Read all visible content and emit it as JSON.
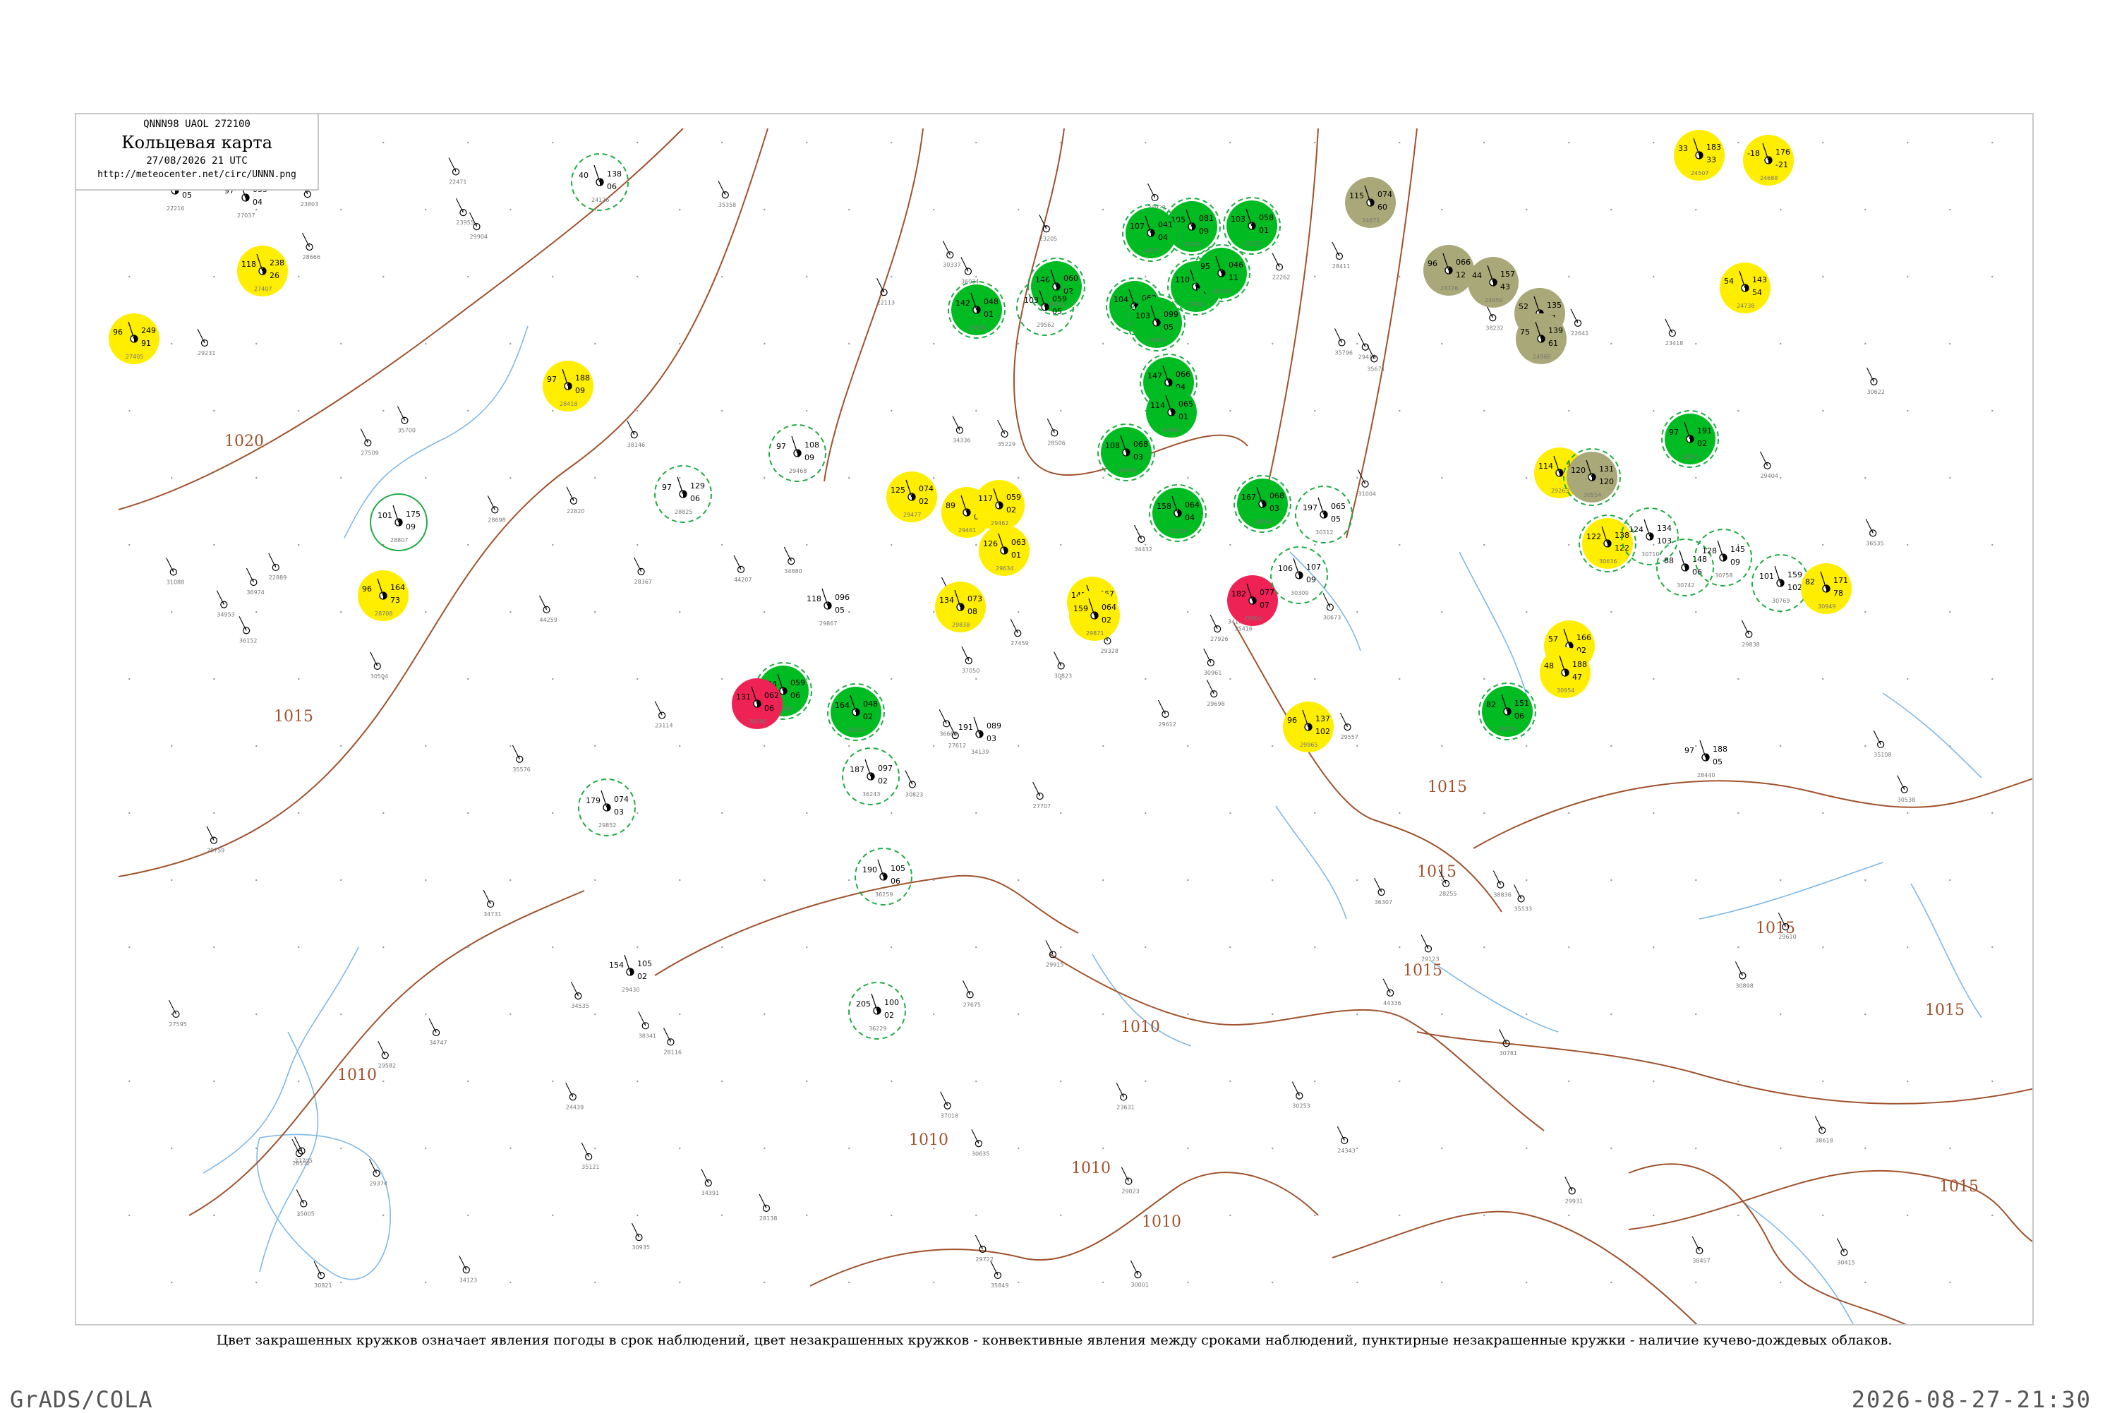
{
  "header": {
    "code": "QNNN98  UAOL  272100",
    "title": "Кольцевая карта",
    "date": "27/08/2026 21 UTC",
    "url": "http://meteocenter.net/circ/UNNN.png"
  },
  "caption": "Цвет закрашенных кружков означает явления погоды в срок наблюдений, цвет незакрашенных кружков - конвективные явления между сроками наблюдений, пунктирные незакрашенные кружки - наличие кучево-дождевых облаков.",
  "footer": {
    "left": "GrADS/COLA",
    "right": "2026-08-27-21:30"
  },
  "colors": {
    "isobar": "#a0522d",
    "river": "#7fb8e6",
    "green": "#00bb22",
    "yellow": "#ffee00",
    "red": "#ee2255",
    "olive": "#a8a878",
    "cb_ring": "#22aa44"
  },
  "isobar_labels": [
    {
      "value": "1020"
    },
    {
      "value": "1015"
    },
    {
      "value": "1015"
    },
    {
      "value": "1015"
    },
    {
      "value": "1015"
    },
    {
      "value": "1015"
    },
    {
      "value": "1010"
    },
    {
      "value": "1010"
    },
    {
      "value": "1010"
    },
    {
      "value": "1010"
    },
    {
      "value": "1010"
    },
    {
      "value": "1015"
    },
    {
      "value": "1015"
    }
  ],
  "stations": [
    {
      "p": "143",
      "t": "97",
      "d": "05",
      "name": "27216",
      "fill": "none",
      "ring": "none"
    },
    {
      "p": "035",
      "t": "97",
      "d": "04",
      "name": "27037",
      "fill": "none",
      "ring": "none"
    },
    {
      "p": "238",
      "t": "118",
      "d": "26",
      "name": "27407",
      "fill": "yellow",
      "ring": "none"
    },
    {
      "p": "249",
      "t": "96",
      "d": "91",
      "name": "27405",
      "fill": "yellow",
      "ring": "none"
    },
    {
      "p": "188",
      "t": "97",
      "d": "09",
      "name": "28418",
      "fill": "yellow",
      "ring": "none"
    },
    {
      "p": "175",
      "t": "101",
      "d": "09",
      "name": "28807",
      "fill": "none",
      "ring": "solid"
    },
    {
      "p": "164",
      "t": "96",
      "d": "73",
      "name": "28708",
      "fill": "yellow",
      "ring": "none"
    },
    {
      "p": "138",
      "t": "40",
      "d": "06",
      "name": "24126",
      "fill": "none",
      "ring": "cb"
    },
    {
      "p": "129",
      "t": "97",
      "d": "06",
      "name": "28825",
      "fill": "none",
      "ring": "cb"
    },
    {
      "p": "108",
      "t": "97",
      "d": "09",
      "name": "29468",
      "fill": "none",
      "ring": "cb"
    },
    {
      "p": "074",
      "t": "125",
      "d": "02",
      "name": "29477",
      "fill": "yellow",
      "ring": "none"
    },
    {
      "p": "063",
      "t": "89",
      "d": "02",
      "name": "29461",
      "fill": "yellow",
      "ring": "none"
    },
    {
      "p": "059",
      "t": "117",
      "d": "02",
      "name": "29462",
      "fill": "yellow",
      "ring": "none"
    },
    {
      "p": "063",
      "t": "126",
      "d": "01",
      "name": "29634",
      "fill": "yellow",
      "ring": "none"
    },
    {
      "p": "073",
      "t": "134",
      "d": "08",
      "name": "29838",
      "fill": "yellow",
      "ring": "none"
    },
    {
      "p": "096",
      "t": "118",
      "d": "05",
      "name": "29867",
      "fill": "none",
      "ring": "none"
    },
    {
      "p": "074",
      "t": "179",
      "d": "03",
      "name": "29852",
      "fill": "none",
      "ring": "cb"
    },
    {
      "p": "059",
      "t": "104",
      "d": "06",
      "name": "36086",
      "fill": "green",
      "ring": "cb"
    },
    {
      "p": "062",
      "t": "131",
      "d": "06",
      "name": "36096",
      "fill": "red",
      "ring": "none"
    },
    {
      "p": "048",
      "t": "164",
      "d": "02",
      "name": "36177",
      "fill": "green",
      "ring": "cb"
    },
    {
      "p": "097",
      "t": "187",
      "d": "02",
      "name": "36243",
      "fill": "none",
      "ring": "cb"
    },
    {
      "p": "100",
      "t": "205",
      "d": "02",
      "name": "36229",
      "fill": "none",
      "ring": "cb"
    },
    {
      "p": "105",
      "t": "190",
      "d": "06",
      "name": "36259",
      "fill": "none",
      "ring": "cb"
    },
    {
      "p": "048",
      "t": "142",
      "d": "01",
      "name": "29638",
      "fill": "green",
      "ring": "cb"
    },
    {
      "p": "060",
      "t": "146",
      "d": "02",
      "name": "29541",
      "fill": "green",
      "ring": "cb"
    },
    {
      "p": "059",
      "t": "103",
      "d": "05",
      "name": "29562",
      "fill": "none",
      "ring": "cb"
    },
    {
      "p": "062",
      "t": "104",
      "d": "04",
      "name": "29572",
      "fill": "green",
      "ring": "cb"
    },
    {
      "p": "081",
      "t": "105",
      "d": "09",
      "name": "29263",
      "fill": "green",
      "ring": "cb"
    },
    {
      "p": "084",
      "t": "110",
      "d": "03",
      "name": "29282",
      "fill": "green",
      "ring": "cb"
    },
    {
      "p": "099",
      "t": "103",
      "d": "05",
      "name": "29363",
      "fill": "green",
      "ring": "cb"
    },
    {
      "p": "066",
      "t": "147",
      "d": "04",
      "name": "29651",
      "fill": "green",
      "ring": "cb"
    },
    {
      "p": "067",
      "t": "145",
      "d": "02",
      "name": "29894",
      "fill": "yellow",
      "ring": "none"
    },
    {
      "p": "064",
      "t": "158",
      "d": "04",
      "name": "30104",
      "fill": "green",
      "ring": "cb"
    },
    {
      "p": "064",
      "t": "159",
      "d": "02",
      "name": "29871",
      "fill": "yellow",
      "ring": "none"
    },
    {
      "p": "068",
      "t": "167",
      "d": "03",
      "name": "30054",
      "fill": "green",
      "ring": "cb"
    },
    {
      "p": "077",
      "t": "182",
      "d": "07",
      "name": "29900",
      "fill": "red",
      "ring": "none"
    },
    {
      "p": "107",
      "t": "106",
      "d": "09",
      "name": "30309",
      "fill": "none",
      "ring": "cb"
    },
    {
      "p": "065",
      "t": "197",
      "d": "05",
      "name": "30312",
      "fill": "none",
      "ring": "cb"
    },
    {
      "p": "137",
      "t": "96",
      "d": "102",
      "name": "29965",
      "fill": "yellow",
      "ring": "none"
    },
    {
      "p": "065",
      "t": "114",
      "d": "01",
      "name": "24951",
      "fill": "green",
      "ring": "none"
    },
    {
      "p": "068",
      "t": "108",
      "d": "03",
      "name": "24944",
      "fill": "green",
      "ring": "cb"
    },
    {
      "p": "041",
      "t": "107",
      "d": "04",
      "name": "24125",
      "fill": "green",
      "ring": "cb"
    },
    {
      "p": "058",
      "t": "103",
      "d": "01",
      "name": "29111",
      "fill": "green",
      "ring": "cb"
    },
    {
      "p": "046",
      "t": "95",
      "d": "11",
      "name": "29134",
      "fill": "green",
      "ring": "cb"
    },
    {
      "p": "074",
      "t": "115",
      "d": "60",
      "name": "24671",
      "fill": "olive",
      "ring": "none"
    },
    {
      "p": "066",
      "t": "96",
      "d": "12",
      "name": "24776",
      "fill": "olive",
      "ring": "none"
    },
    {
      "p": "157",
      "t": "44",
      "d": "43",
      "name": "24959",
      "fill": "olive",
      "ring": "none"
    },
    {
      "p": "135",
      "t": "52",
      "d": "51",
      "name": "24963",
      "fill": "olive",
      "ring": "none"
    },
    {
      "p": "139",
      "t": "75",
      "d": "61",
      "name": "24966",
      "fill": "olive",
      "ring": "none"
    },
    {
      "p": "183",
      "t": "33",
      "d": "33",
      "name": "24507",
      "fill": "yellow",
      "ring": "none"
    },
    {
      "p": "176",
      "t": "-18",
      "d": "-21",
      "name": "24688",
      "fill": "yellow",
      "ring": "none"
    },
    {
      "p": "143",
      "t": "54",
      "d": "54",
      "name": "24738",
      "fill": "yellow",
      "ring": "none"
    },
    {
      "p": "120",
      "t": "114",
      "d": "109",
      "name": "29263",
      "fill": "yellow",
      "ring": "none"
    },
    {
      "p": "131",
      "t": "120",
      "d": "120",
      "name": "30554",
      "fill": "olive",
      "ring": "cb"
    },
    {
      "p": "138",
      "t": "122",
      "d": "122",
      "name": "30636",
      "fill": "yellow",
      "ring": "cb"
    },
    {
      "p": "134",
      "t": "124",
      "d": "103",
      "name": "30710",
      "fill": "none",
      "ring": "cb"
    },
    {
      "p": "148",
      "t": "88",
      "d": "06",
      "name": "30742",
      "fill": "none",
      "ring": "cb"
    },
    {
      "p": "145",
      "t": "128",
      "d": "09",
      "name": "30758",
      "fill": "none",
      "ring": "cb"
    },
    {
      "p": "159",
      "t": "101",
      "d": "102",
      "name": "30769",
      "fill": "none",
      "ring": "cb"
    },
    {
      "p": "171",
      "t": "82",
      "d": "78",
      "name": "30949",
      "fill": "yellow",
      "ring": "none"
    },
    {
      "p": "166",
      "t": "57",
      "d": "02",
      "name": "30965",
      "fill": "yellow",
      "ring": "none"
    },
    {
      "p": "188",
      "t": "48",
      "d": "47",
      "name": "30954",
      "fill": "yellow",
      "ring": "none"
    },
    {
      "p": "151",
      "t": "82",
      "d": "06",
      "name": "30374",
      "fill": "green",
      "ring": "cb"
    },
    {
      "p": "191",
      "t": "97",
      "d": "02",
      "name": "30872",
      "fill": "green",
      "ring": "cb"
    },
    {
      "p": "188",
      "t": "97",
      "d": "05",
      "name": "28440",
      "fill": "none",
      "ring": "none"
    },
    {
      "p": "089",
      "t": "191",
      "d": "03",
      "name": "34139",
      "fill": "none",
      "ring": "none"
    },
    {
      "p": "105",
      "t": "154",
      "d": "02",
      "name": "29430",
      "fill": "none",
      "ring": "none"
    }
  ],
  "plain_station_names": [
    "27707",
    "27509",
    "27612",
    "27705",
    "27926",
    "28116",
    "28411",
    "28506",
    "29418",
    "29612",
    "29904",
    "30415",
    "30504",
    "30622",
    "30823",
    "31004",
    "34123",
    "34336",
    "34432",
    "34747",
    "34880",
    "35005",
    "35121",
    "35229",
    "35416",
    "35533",
    "35700",
    "36034",
    "36152",
    "36307",
    "36535",
    "36665",
    "37018",
    "37050",
    "38146",
    "38232",
    "38341",
    "38457",
    "38618",
    "38836",
    "38927",
    "44207",
    "44259",
    "44336",
    "30935",
    "31088",
    "30961",
    "30821",
    "30635",
    "29698",
    "29582",
    "29404",
    "29231",
    "29123",
    "24343",
    "24439",
    "23955",
    "23803",
    "23631",
    "23418",
    "23205",
    "23114",
    "22889",
    "22820",
    "22641",
    "22471",
    "22262",
    "22113",
    "27459",
    "27595",
    "27675",
    "28138",
    "28255",
    "28367",
    "28552",
    "28666",
    "28698",
    "28759",
    "28900",
    "29023",
    "29328",
    "29374",
    "29557",
    "29610",
    "29722",
    "29838",
    "29915",
    "29931",
    "30001",
    "30253",
    "30337",
    "30538",
    "30673",
    "30781",
    "30823",
    "30898",
    "36974",
    "35849",
    "35796",
    "35671",
    "35576",
    "35358",
    "35108",
    "34953",
    "34731",
    "34535",
    "34391",
    "34180"
  ]
}
